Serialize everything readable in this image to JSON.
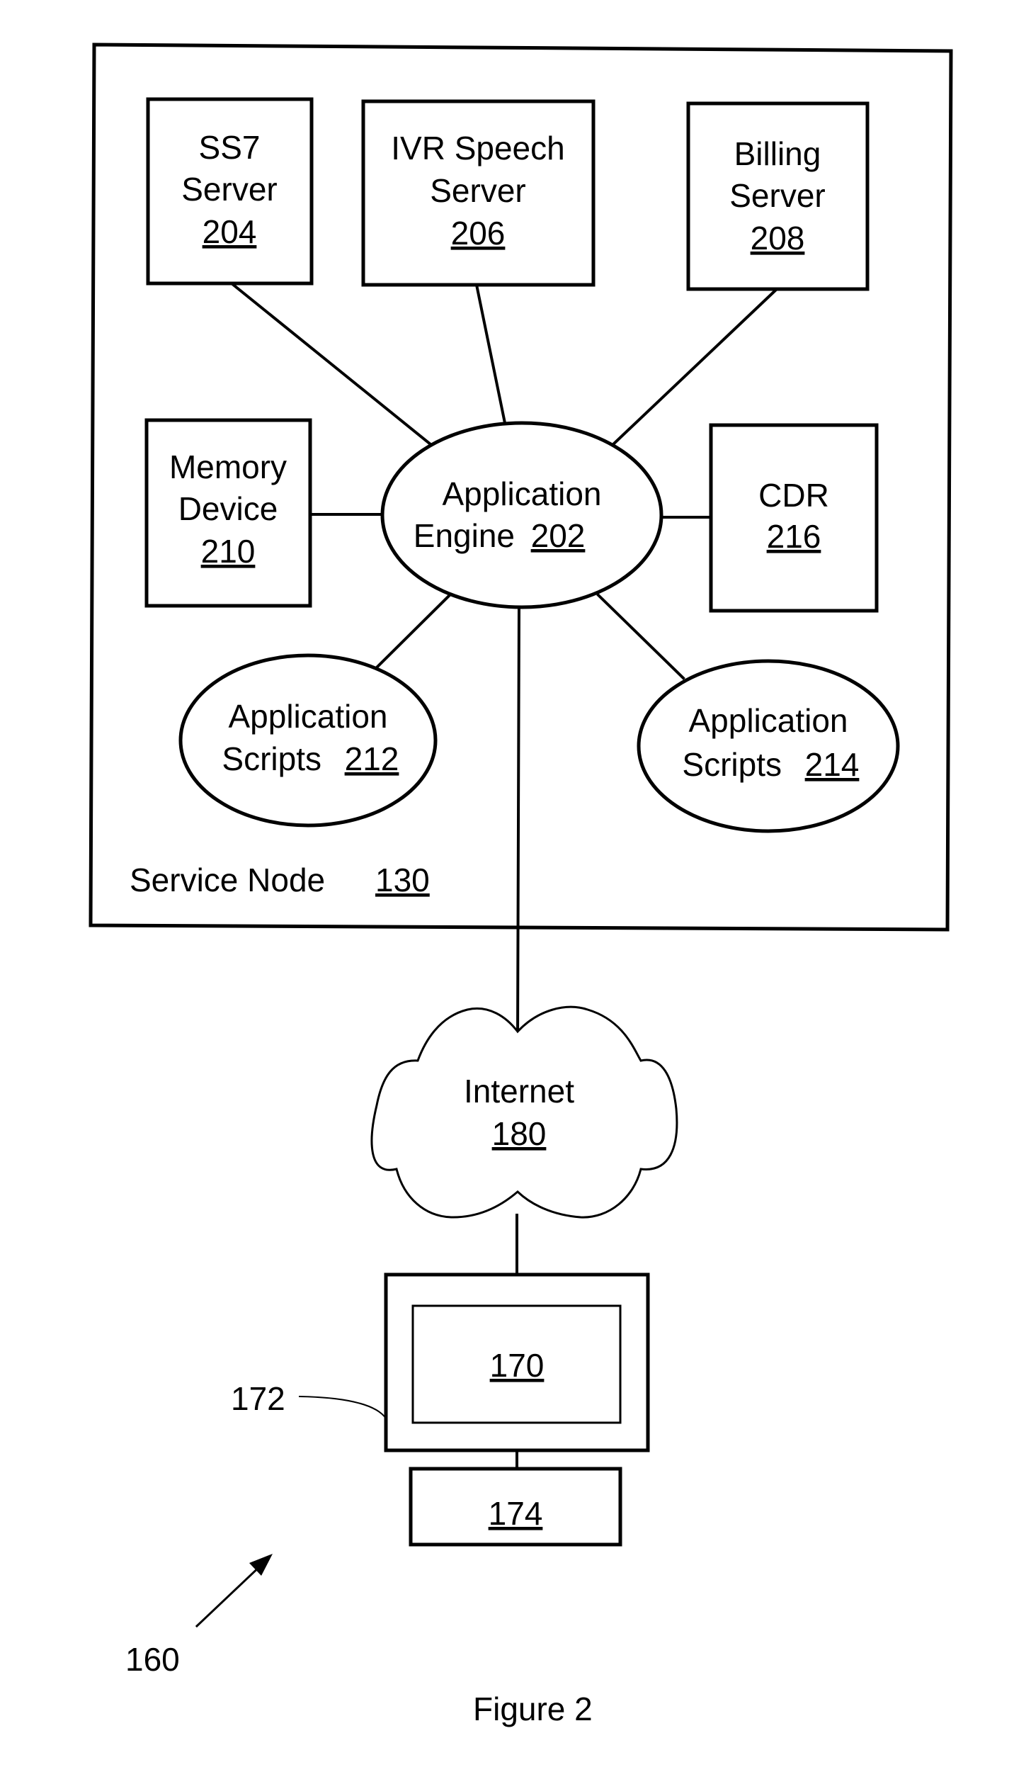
{
  "figure": {
    "caption": "Figure 2",
    "system_ref": "160"
  },
  "service_node": {
    "label": "Service Node",
    "ref": "130"
  },
  "nodes": {
    "ss7_server": {
      "lines": [
        "SS7",
        "Server"
      ],
      "ref": "204"
    },
    "ivr_speech_server": {
      "lines": [
        "IVR Speech",
        "Server"
      ],
      "ref": "206"
    },
    "billing_server": {
      "lines": [
        "Billing",
        "Server"
      ],
      "ref": "208"
    },
    "memory_device": {
      "lines": [
        "Memory",
        "Device"
      ],
      "ref": "210"
    },
    "application_engine": {
      "lines": [
        "Application",
        "Engine"
      ],
      "ref": "202"
    },
    "cdr": {
      "lines": [
        "CDR"
      ],
      "ref": "216"
    },
    "application_scripts_212": {
      "lines": [
        "Application",
        "Scripts"
      ],
      "ref": "212"
    },
    "application_scripts_214": {
      "lines": [
        "Application",
        "Scripts"
      ],
      "ref": "214"
    }
  },
  "internet": {
    "label": "Internet",
    "ref": "180"
  },
  "client": {
    "monitor_ref": "172",
    "screen_ref": "170",
    "base_ref": "174"
  },
  "connections": [
    [
      "application_engine",
      "ss7_server"
    ],
    [
      "application_engine",
      "ivr_speech_server"
    ],
    [
      "application_engine",
      "billing_server"
    ],
    [
      "application_engine",
      "memory_device"
    ],
    [
      "application_engine",
      "cdr"
    ],
    [
      "application_engine",
      "application_scripts_212"
    ],
    [
      "application_engine",
      "application_scripts_214"
    ],
    [
      "application_engine",
      "internet"
    ],
    [
      "internet",
      "client_monitor"
    ],
    [
      "client_monitor",
      "client_base"
    ]
  ]
}
